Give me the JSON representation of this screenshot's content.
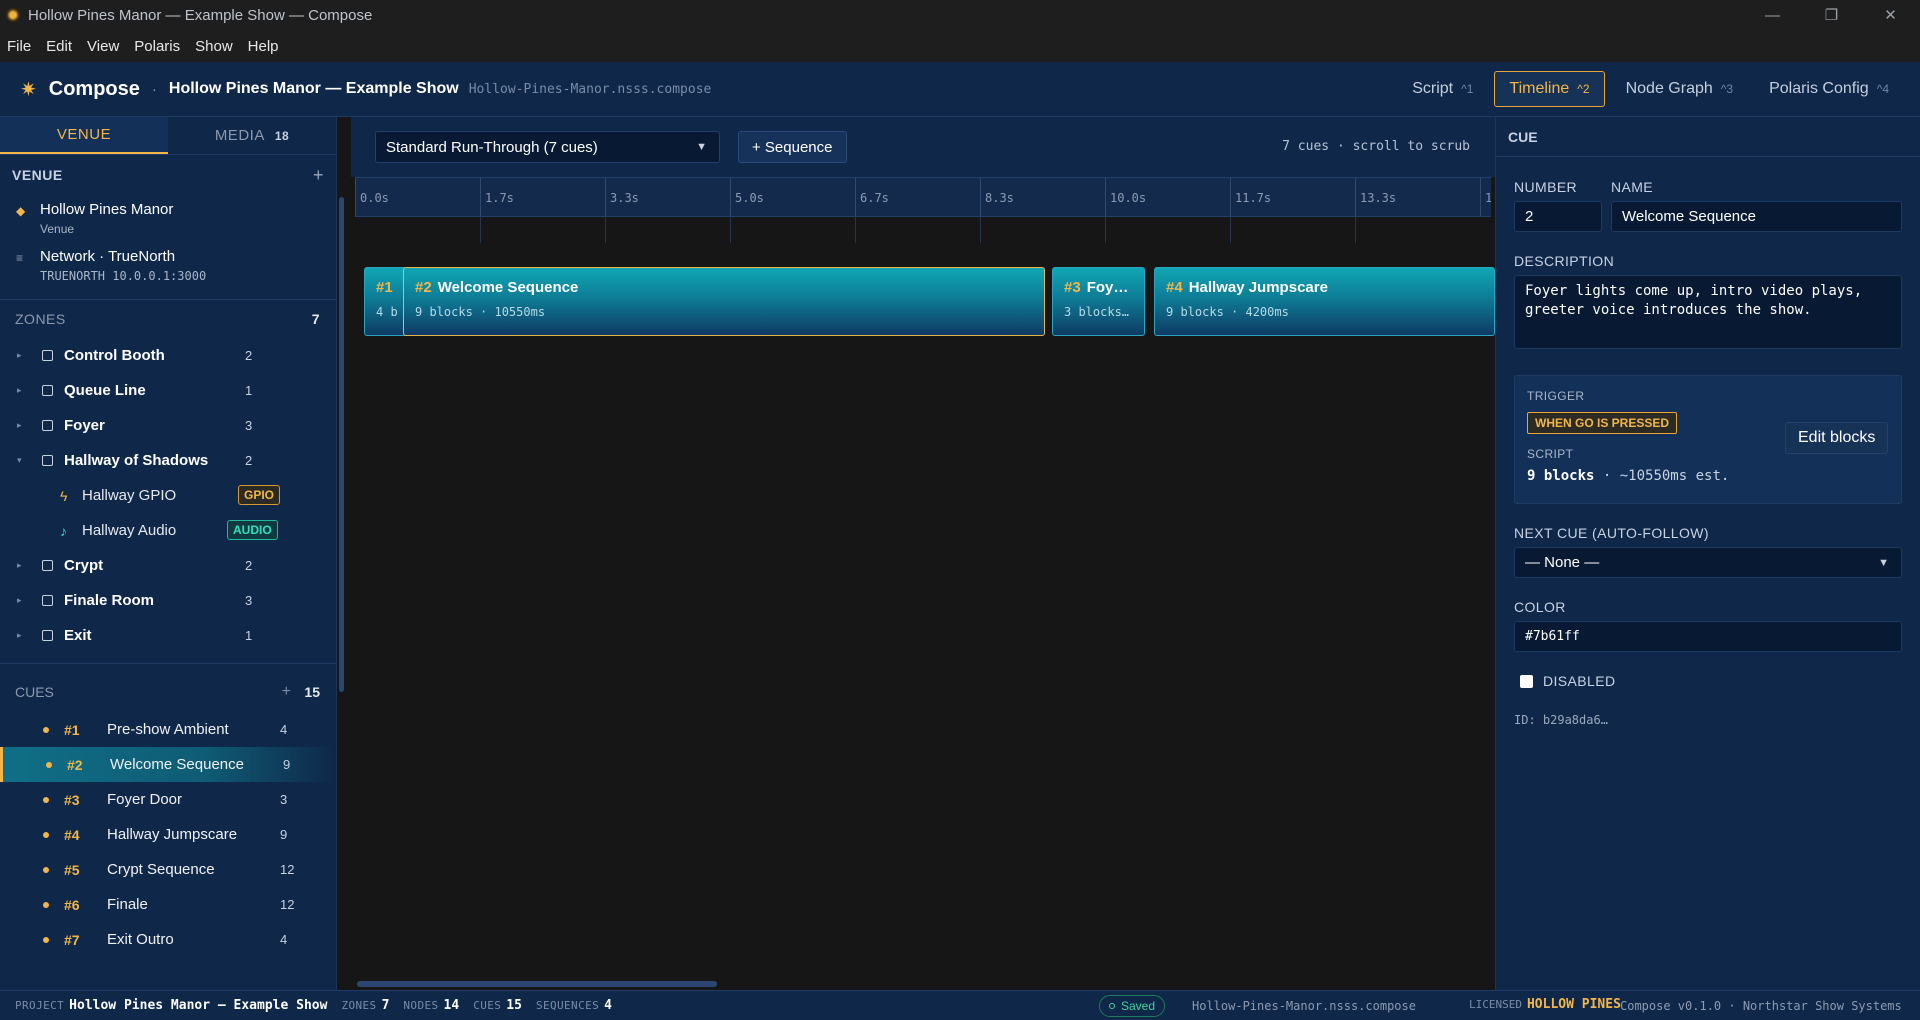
{
  "window": {
    "title": "Hollow Pines Manor — Example Show — Compose"
  },
  "menu": [
    "File",
    "Edit",
    "View",
    "Polaris",
    "Show",
    "Help"
  ],
  "header": {
    "brand": "Compose",
    "show_title": "Hollow Pines Manor — Example Show",
    "file": "Hollow-Pines-Manor.nsss.compose",
    "tabs": [
      {
        "label": "Script",
        "shortcut": "^1"
      },
      {
        "label": "Timeline",
        "shortcut": "^2",
        "active": true
      },
      {
        "label": "Node Graph",
        "shortcut": "^3"
      },
      {
        "label": "Polaris Config",
        "shortcut": "^4"
      }
    ]
  },
  "left": {
    "tabs": [
      {
        "label": "VENUE"
      },
      {
        "label": "MEDIA",
        "count": "18"
      }
    ],
    "venue_title": "VENUE",
    "venue": {
      "name": "Hollow Pines Manor",
      "kind": "Venue"
    },
    "network": {
      "name": "Network · TrueNorth",
      "address": "TRUENORTH 10.0.0.1:3000"
    },
    "zones_title": "ZONES",
    "zones_count": "7",
    "zones": [
      {
        "name": "Control Booth",
        "count": "2"
      },
      {
        "name": "Queue Line",
        "count": "1"
      },
      {
        "name": "Foyer",
        "count": "3"
      },
      {
        "name": "Hallway of Shadows",
        "count": "2",
        "expanded": true
      },
      {
        "name": "Crypt",
        "count": "2"
      },
      {
        "name": "Finale Room",
        "count": "3"
      },
      {
        "name": "Exit",
        "count": "1"
      }
    ],
    "zone_children": [
      {
        "name": "Hallway GPIO",
        "badge": "GPIO"
      },
      {
        "name": "Hallway Audio",
        "badge": "AUDIO"
      }
    ],
    "cues_title": "CUES",
    "cues_count": "15",
    "cues": [
      {
        "num": "#1",
        "name": "Pre-show Ambient",
        "count": "4"
      },
      {
        "num": "#2",
        "name": "Welcome Sequence",
        "count": "9",
        "selected": true
      },
      {
        "num": "#3",
        "name": "Foyer Door",
        "count": "3"
      },
      {
        "num": "#4",
        "name": "Hallway Jumpscare",
        "count": "9"
      },
      {
        "num": "#5",
        "name": "Crypt Sequence",
        "count": "12"
      },
      {
        "num": "#6",
        "name": "Finale",
        "count": "12"
      },
      {
        "num": "#7",
        "name": "Exit Outro",
        "count": "4"
      }
    ]
  },
  "timeline": {
    "sequence": "Standard Run-Through (7 cues)",
    "add_sequence": "+ Sequence",
    "info": "7 cues · scroll to scrub",
    "ticks": [
      "0.0s",
      "1.7s",
      "3.3s",
      "5.0s",
      "6.7s",
      "8.3s",
      "10.0s",
      "11.7s",
      "13.3s",
      "1"
    ],
    "blocks": [
      {
        "num": "#1",
        "name": "",
        "sub": "4 b"
      },
      {
        "num": "#2",
        "name": "Welcome Sequence",
        "sub": "9 blocks · 10550ms",
        "selected": true
      },
      {
        "num": "#3",
        "name": "Foy…",
        "sub": "3 blocks…"
      },
      {
        "num": "#4",
        "name": "Hallway Jumpscare",
        "sub": "9 blocks · 4200ms"
      }
    ]
  },
  "inspector": {
    "title": "CUE",
    "number_label": "NUMBER",
    "number": "2",
    "name_label": "NAME",
    "name": "Welcome Sequence",
    "description_label": "DESCRIPTION",
    "description": "Foyer lights come up, intro video plays, greeter voice introduces the show.",
    "trigger_label": "TRIGGER",
    "trigger": "WHEN GO IS PRESSED",
    "script_label": "SCRIPT",
    "script_blocks": "9 blocks",
    "script_est": " · ~10550ms est.",
    "edit_blocks": "Edit blocks",
    "next_cue_label": "NEXT CUE (AUTO-FOLLOW)",
    "next_cue": "— None —",
    "color_label": "COLOR",
    "color": "#7b61ff",
    "disabled_label": "DISABLED",
    "id": "ID: b29a8da6…"
  },
  "status": {
    "project_label": "PROJECT",
    "project": "Hollow Pines Manor — Example Show",
    "zones_label": "ZONES",
    "zones": "7",
    "nodes_label": "NODES",
    "nodes": "14",
    "cues_label": "CUES",
    "cues": "15",
    "sequences_label": "SEQUENCES",
    "sequences": "4",
    "saved": "Saved",
    "file": "Hollow-Pines-Manor.nsss.compose",
    "licensed_label": "LICENSED",
    "licensed": "HOLLOW PINES",
    "version": "Compose v0.1.0 · Northstar Show Systems"
  },
  "colors": {
    "accent": "#f2b64a",
    "panel": "#0f2749",
    "cue_block": "#11a6b5",
    "saved": "#40d39a",
    "audio_badge": "#2ee0c0"
  }
}
